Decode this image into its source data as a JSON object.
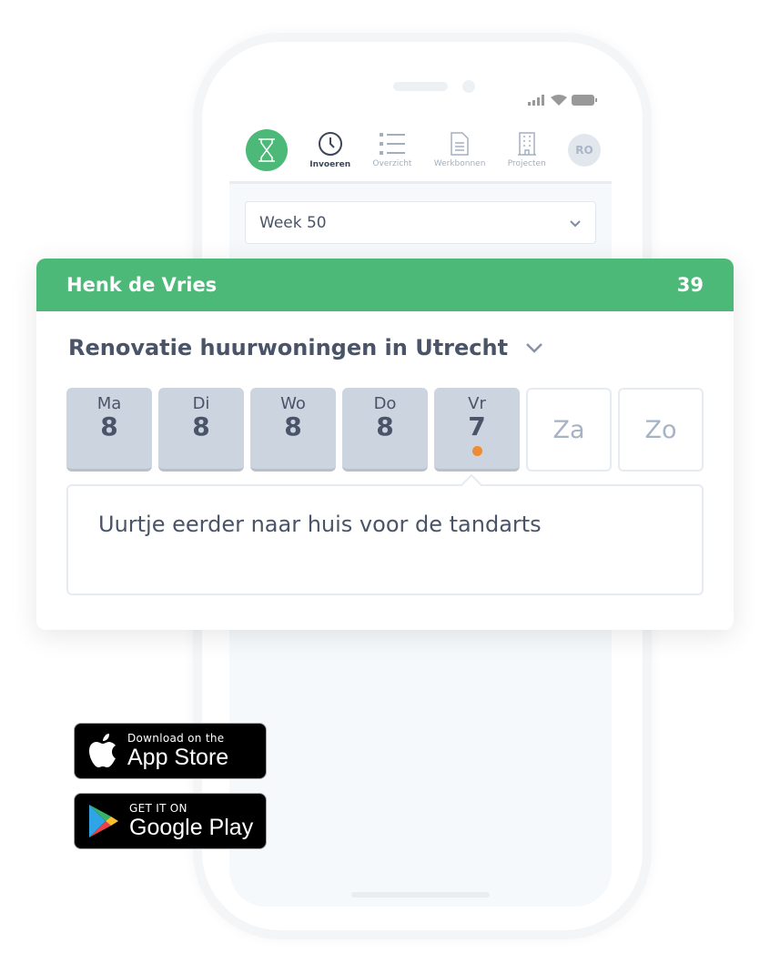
{
  "app": {
    "nav": [
      {
        "label": "Invoeren",
        "icon": "clock-icon",
        "active": true
      },
      {
        "label": "Overzicht",
        "icon": "list-icon"
      },
      {
        "label": "Werkbonnen",
        "icon": "document-icon"
      },
      {
        "label": "Projecten",
        "icon": "building-icon"
      }
    ],
    "avatar": "RO",
    "week": "Week 50"
  },
  "card": {
    "name": "Henk de Vries",
    "total": "39",
    "project": "Renovatie huurwoningen in Utrecht",
    "days": [
      {
        "label": "Ma",
        "hours": "8"
      },
      {
        "label": "Di",
        "hours": "8"
      },
      {
        "label": "Wo",
        "hours": "8"
      },
      {
        "label": "Do",
        "hours": "8"
      },
      {
        "label": "Vr",
        "hours": "7"
      },
      {
        "label": "Za"
      },
      {
        "label": "Zo"
      }
    ],
    "note": "Uurtje eerder naar huis voor de tandarts"
  },
  "badges": {
    "appstore_small": "Download on the",
    "appstore_big": "App Store",
    "play_small": "GET IT ON",
    "play_big": "Google Play"
  },
  "colors": {
    "accent": "#4cb978",
    "note_dot": "#ef8b33"
  }
}
